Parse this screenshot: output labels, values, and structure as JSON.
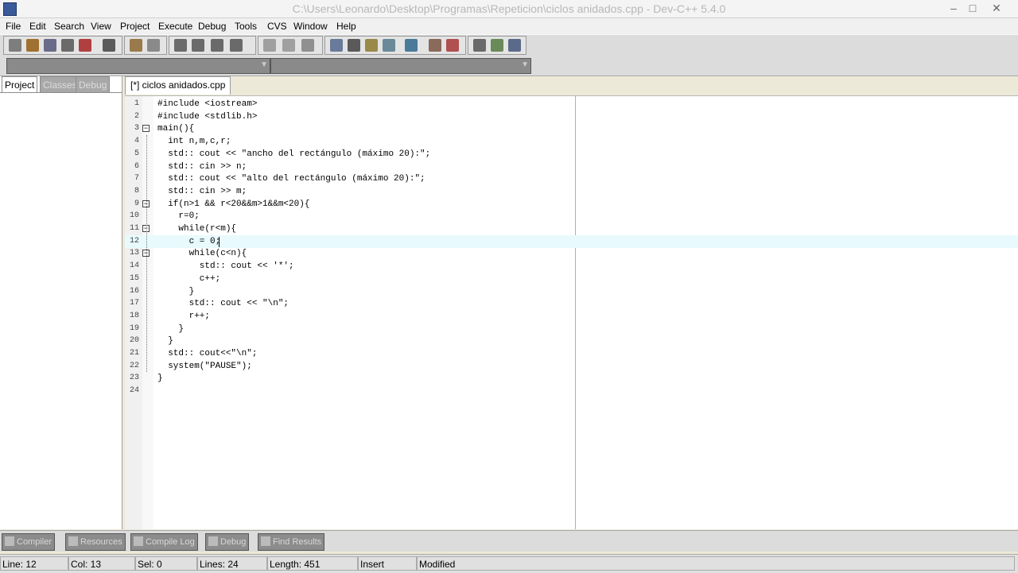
{
  "window": {
    "title": "C:\\Users\\Leonardo\\Desktop\\Programas\\Repeticion\\ciclos anidados.cpp - Dev-C++ 5.4.0"
  },
  "menu": [
    "File",
    "Edit",
    "Search",
    "View",
    "Project",
    "Execute",
    "Debug",
    "Tools",
    "CVS",
    "Window",
    "Help"
  ],
  "left_panel": {
    "tabs": [
      "Project",
      "Classes",
      "Debug"
    ]
  },
  "editor": {
    "tab_label": "[*] ciclos anidados.cpp",
    "lines": [
      {
        "n": "1",
        "text": "#include <iostream>"
      },
      {
        "n": "2",
        "text": "#include <stdlib.h>"
      },
      {
        "n": "3",
        "text": "main(){"
      },
      {
        "n": "4",
        "text": "  int n,m,c,r;"
      },
      {
        "n": "5",
        "text": "  std:: cout << \"ancho del rectángulo (máximo 20):\";"
      },
      {
        "n": "6",
        "text": "  std:: cin >> n;"
      },
      {
        "n": "7",
        "text": "  std:: cout << \"alto del rectángulo (máximo 20):\";"
      },
      {
        "n": "8",
        "text": "  std:: cin >> m;"
      },
      {
        "n": "9",
        "text": "  if(n>1 && r<20&&m>1&&m<20){"
      },
      {
        "n": "10",
        "text": "    r=0;"
      },
      {
        "n": "11",
        "text": "    while(r<m){"
      },
      {
        "n": "12",
        "text": "      c = 0;"
      },
      {
        "n": "13",
        "text": "      while(c<n){"
      },
      {
        "n": "14",
        "text": "        std:: cout << '*';"
      },
      {
        "n": "15",
        "text": "        c++;"
      },
      {
        "n": "16",
        "text": "      }"
      },
      {
        "n": "17",
        "text": "      std:: cout << \"\\n\";"
      },
      {
        "n": "18",
        "text": "      r++;"
      },
      {
        "n": "19",
        "text": "    }"
      },
      {
        "n": "20",
        "text": "  }"
      },
      {
        "n": "21",
        "text": "  std:: cout<<\"\\n\";"
      },
      {
        "n": "22",
        "text": "  system(\"PAUSE\");"
      },
      {
        "n": "23",
        "text": "}"
      },
      {
        "n": "24",
        "text": ""
      }
    ]
  },
  "bottom_tabs": [
    "Compiler",
    "Resources",
    "Compile Log",
    "Debug",
    "Find Results"
  ],
  "status": {
    "line": "Line:   12",
    "col": "Col:   13",
    "sel": "Sel:   0",
    "lines": "Lines:   24",
    "length": "Length:   451",
    "mode": "Insert",
    "modified": "Modified"
  },
  "colors": {
    "current_line": "#e8fafd",
    "background": "#ece9d8"
  }
}
